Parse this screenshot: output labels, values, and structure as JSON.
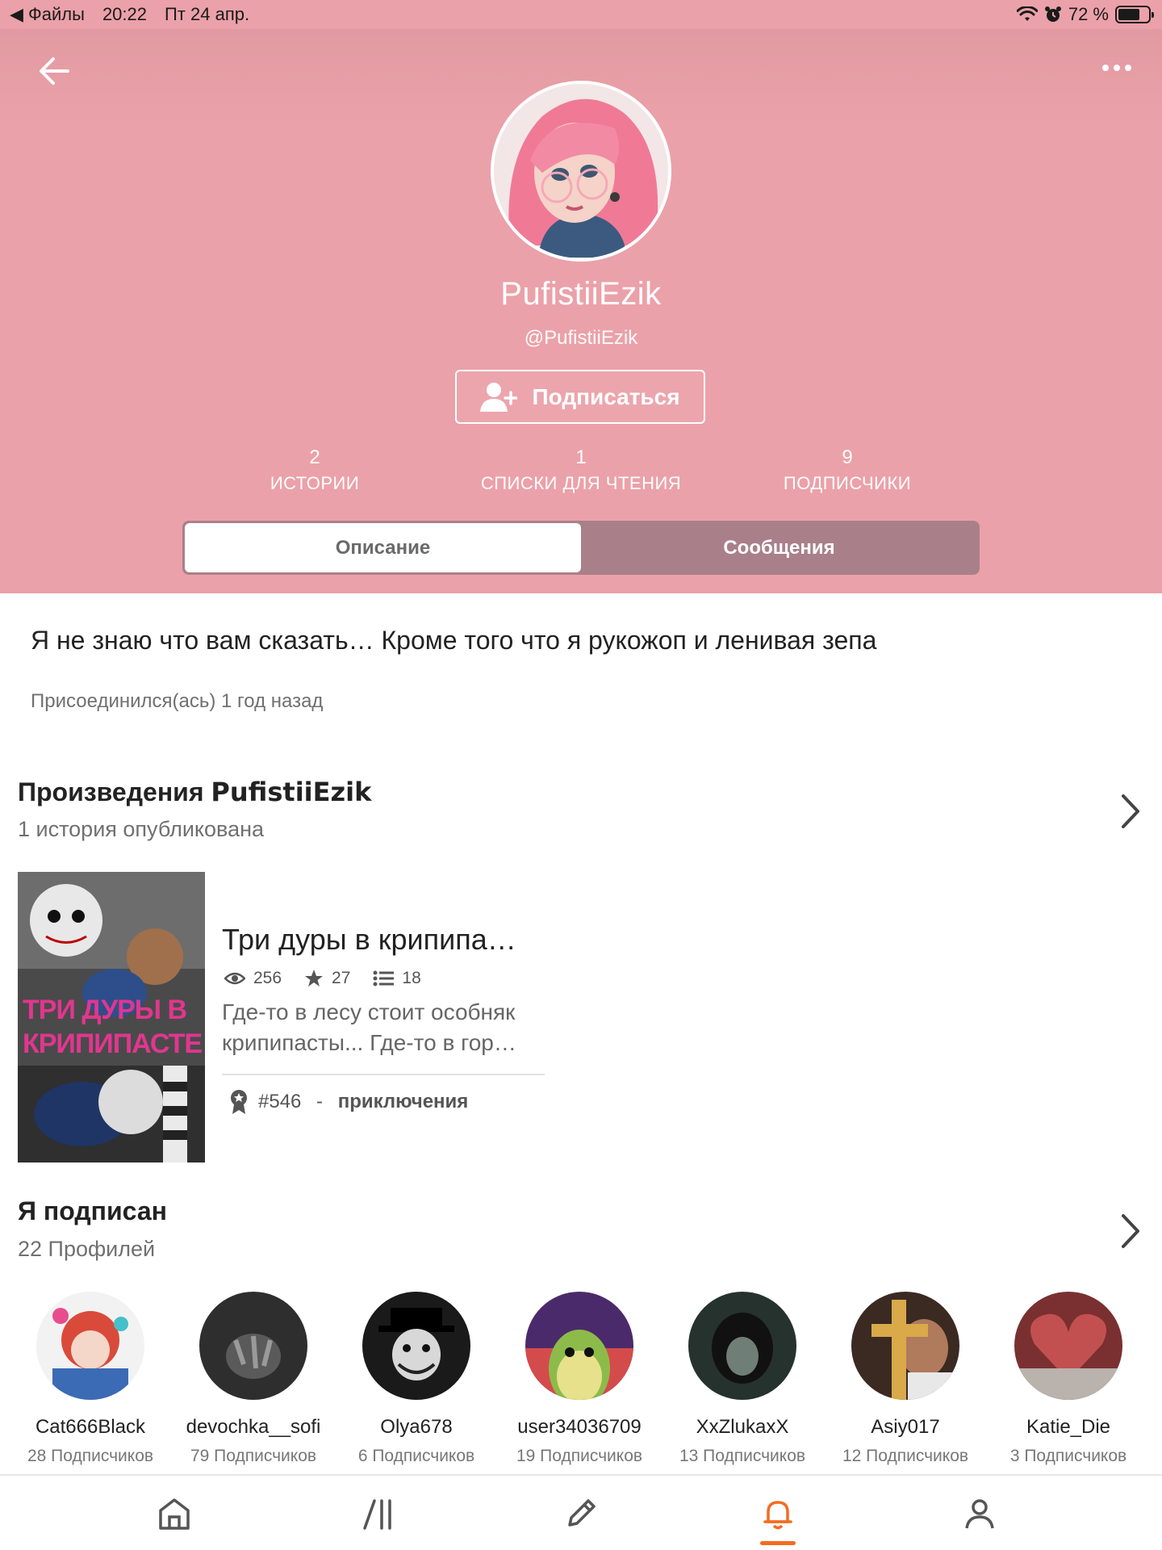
{
  "status_bar": {
    "back_app": "◀ Файлы",
    "time": "20:22",
    "date": "Пт 24 апр.",
    "battery": "72 %",
    "battery_level": 0.72
  },
  "profile": {
    "display_name": "PufistiiEzik",
    "handle": "@PufistiiEzik",
    "follow_label": "Подписаться"
  },
  "stats": [
    {
      "value": "2",
      "label": "ИСТОРИИ"
    },
    {
      "value": "1",
      "label": "СПИСКИ ДЛЯ ЧТЕНИЯ"
    },
    {
      "value": "9",
      "label": "ПОДПИСЧИКИ"
    }
  ],
  "tabs": [
    {
      "label": "Описание",
      "active": true
    },
    {
      "label": "Сообщения",
      "active": false
    }
  ],
  "about": {
    "bio": "Я не знаю что вам сказать… Кроме того что я рукожоп и ленивая зепа",
    "joined": "Присоединился(ась) 1 год назад"
  },
  "works": {
    "title_prefix": "Произведения",
    "title_name": "PufistiiEzik",
    "subtitle": "1 история опубликована",
    "story": {
      "title": "Три дуры в крипипа…",
      "cover_text": "ТРИ ДУРЫ В КРИПИПАСТЕ",
      "views": "256",
      "votes": "27",
      "parts": "18",
      "description": "Где-то в лесу стоит особняк крипипасты... Где-то в гор…",
      "rank": "#546",
      "rank_separator": " - ",
      "rank_category": "приключения"
    }
  },
  "following": {
    "title": "Я подписан",
    "subtitle": "22 Профилей",
    "profiles": [
      {
        "name": "Cat666Black",
        "followers": "28 Подписчиков"
      },
      {
        "name": "devochka__sofi",
        "followers": "79 Подписчиков"
      },
      {
        "name": "Olya678",
        "followers": "6 Подписчиков"
      },
      {
        "name": "user34036709",
        "followers": "19 Подписчиков"
      },
      {
        "name": "XxZlukaxX",
        "followers": "13 Подписчиков"
      },
      {
        "name": "Asiy017",
        "followers": "12 Подписчиков"
      },
      {
        "name": "Katie_Die",
        "followers": "3 Подписчиков"
      }
    ]
  },
  "bottom_nav": [
    {
      "icon": "home-icon",
      "active": false
    },
    {
      "icon": "library-icon",
      "active": false
    },
    {
      "icon": "pencil-icon",
      "active": false
    },
    {
      "icon": "bell-icon",
      "active": true
    },
    {
      "icon": "profile-icon",
      "active": false
    }
  ],
  "colors": {
    "header_bg": "#eba1a9",
    "tabs_bg": "#a9808a",
    "accent": "#f36c22"
  }
}
